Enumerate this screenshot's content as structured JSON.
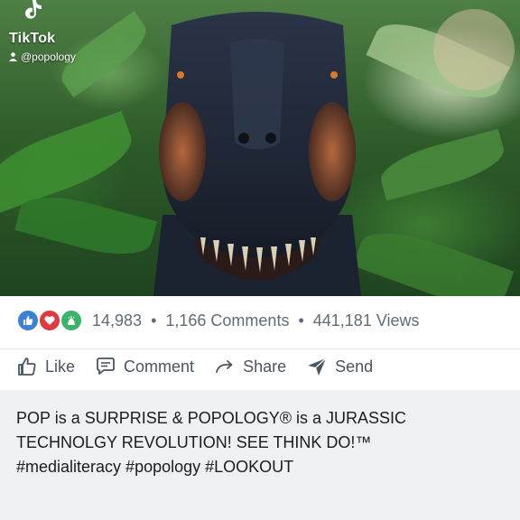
{
  "video": {
    "brand": "TikTok",
    "username": "@popology"
  },
  "social": {
    "reaction_count": "14,983",
    "comments": "1,166 Comments",
    "views": "441,181 Views",
    "separator": "•",
    "colors": {
      "like": "#3b82d6",
      "love": "#e0393e",
      "celebrate": "#3bb36a"
    }
  },
  "actions": {
    "like": "Like",
    "comment": "Comment",
    "share": "Share",
    "send": "Send"
  },
  "post": {
    "text": "POP is a SURPRISE & POPOLOGY® is a JURASSIC\nTECHNOLGY REVOLUTION! SEE THINK DO!™\n#medialiteracy #popology #LOOKOUT"
  }
}
